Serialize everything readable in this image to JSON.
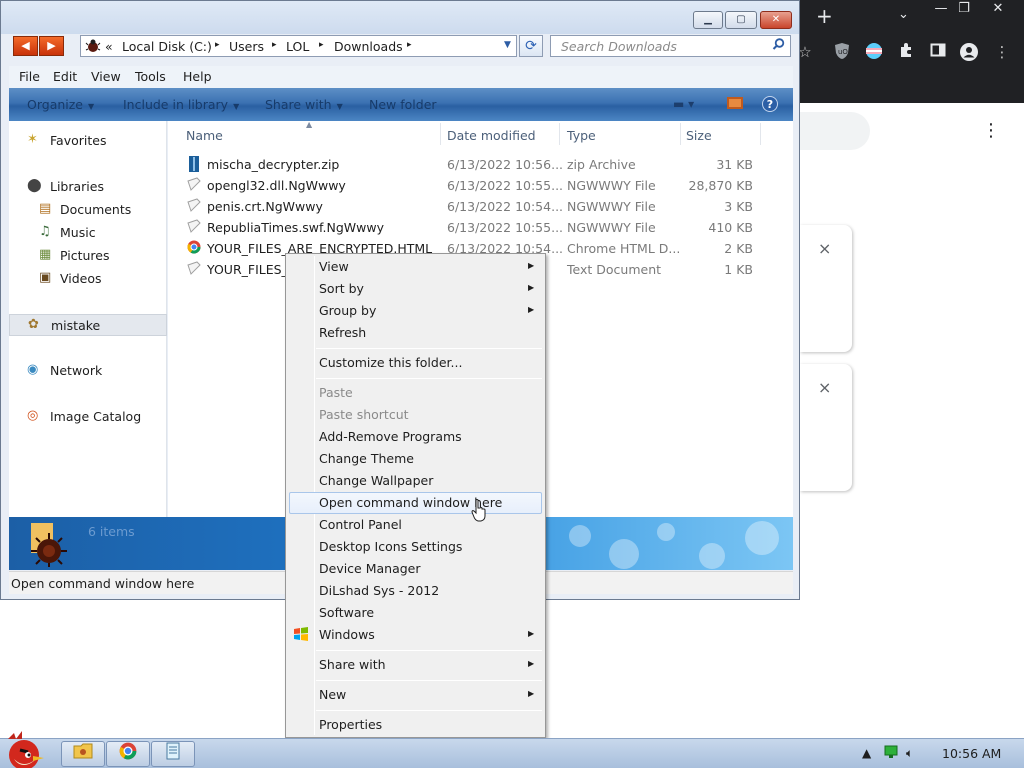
{
  "colors": {
    "chrome_dark": "#202124",
    "explorer_toolbar": "#3b71b2",
    "details_pane": "#1f74c4",
    "menu_bg": "#f0f0f0",
    "menu_hover_border": "#a9c6ea"
  },
  "chrome": {
    "new_tab_label": "+",
    "tab_dropdown_icon": "chevron-down-icon",
    "window_controls": [
      "minimize-icon",
      "restore-icon",
      "close-icon"
    ],
    "extensions": [
      "star-icon",
      "ublock-icon",
      "trans-flag-icon",
      "puzzle-icon",
      "sidepanel-icon",
      "profile-icon",
      "kebab-icon"
    ],
    "card_close": "×"
  },
  "explorer": {
    "window_controls": {
      "minimize": "▁",
      "maximize": "▢",
      "close": "✕"
    },
    "breadcrumb": {
      "lead": "«",
      "segments": [
        "Local Disk (C:)",
        "Users",
        "LOL",
        "Downloads"
      ],
      "separator": "▸"
    },
    "search": {
      "placeholder": "Search Downloads"
    },
    "menubar": [
      "File",
      "Edit",
      "View",
      "Tools",
      "Help"
    ],
    "toolbar": {
      "organize": "Organize",
      "include": "Include in library",
      "share": "Share with",
      "new_folder": "New folder"
    },
    "navpane": {
      "favorites": "Favorites",
      "libraries": "Libraries",
      "library_items": [
        "Documents",
        "Music",
        "Pictures",
        "Videos"
      ],
      "user": "mistake",
      "network": "Network",
      "image_catalog": "Image Catalog"
    },
    "columns": {
      "name": "Name",
      "date": "Date modified",
      "type": "Type",
      "size": "Size"
    },
    "files": [
      {
        "name": "mischa_decrypter.zip",
        "date": "6/13/2022 10:56...",
        "type": "zip Archive",
        "size": "31 KB",
        "icon": "zip-icon"
      },
      {
        "name": "opengl32.dll.NgWwwy",
        "date": "6/13/2022 10:55...",
        "type": "NGWWWY File",
        "size": "28,870 KB",
        "icon": "file-icon"
      },
      {
        "name": "penis.crt.NgWwwy",
        "date": "6/13/2022 10:54...",
        "type": "NGWWWY File",
        "size": "3 KB",
        "icon": "file-icon"
      },
      {
        "name": "RepubliaTimes.swf.NgWwwy",
        "date": "6/13/2022 10:55...",
        "type": "NGWWWY File",
        "size": "410 KB",
        "icon": "file-icon"
      },
      {
        "name": "YOUR_FILES_ARE_ENCRYPTED.HTML",
        "date": "6/13/2022 10:54...",
        "type": "Chrome HTML D...",
        "size": "2 KB",
        "icon": "chrome-icon"
      },
      {
        "name": "YOUR_FILES_A",
        "date": "",
        "type": "Text Document",
        "size": "1 KB",
        "icon": "text-file-icon"
      }
    ],
    "details": {
      "count": "6 items"
    },
    "status": "Open command window here"
  },
  "context_menu": {
    "items": [
      {
        "label": "View",
        "submenu": true,
        "disabled": false
      },
      {
        "label": "Sort by",
        "submenu": true,
        "disabled": false
      },
      {
        "label": "Group by",
        "submenu": true,
        "disabled": false
      },
      {
        "label": "Refresh",
        "submenu": false,
        "disabled": false
      },
      {
        "label": "Customize this folder...",
        "submenu": false,
        "disabled": false
      },
      {
        "label": "Paste",
        "submenu": false,
        "disabled": true
      },
      {
        "label": "Paste shortcut",
        "submenu": false,
        "disabled": true
      },
      {
        "label": "Add-Remove Programs",
        "submenu": false,
        "disabled": false
      },
      {
        "label": "Change Theme",
        "submenu": false,
        "disabled": false
      },
      {
        "label": "Change Wallpaper",
        "submenu": false,
        "disabled": false
      },
      {
        "label": "Open command window here",
        "submenu": false,
        "disabled": false,
        "hover": true
      },
      {
        "label": "Control Panel",
        "submenu": false,
        "disabled": false
      },
      {
        "label": "Desktop Icons Settings",
        "submenu": false,
        "disabled": false
      },
      {
        "label": "Device Manager",
        "submenu": false,
        "disabled": false
      },
      {
        "label": "DiLshad Sys - 2012",
        "submenu": false,
        "disabled": false
      },
      {
        "label": "Software",
        "submenu": false,
        "disabled": false
      },
      {
        "label": "Windows",
        "submenu": true,
        "disabled": false,
        "icon": "windows-flag-icon"
      },
      {
        "label": "Share with",
        "submenu": true,
        "disabled": false
      },
      {
        "label": "New",
        "submenu": true,
        "disabled": false
      },
      {
        "label": "Properties",
        "submenu": false,
        "disabled": false
      }
    ]
  },
  "taskbar": {
    "clock": "10:56 AM",
    "buttons": [
      "explorer-icon",
      "chrome-icon",
      "notepad-icon"
    ]
  }
}
